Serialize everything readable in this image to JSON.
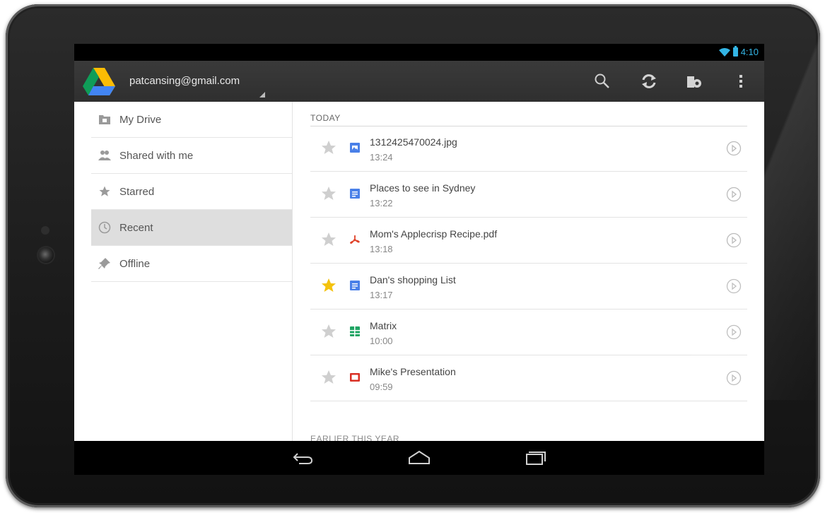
{
  "status_bar": {
    "time": "4:10",
    "wifi_icon": "wifi-icon",
    "battery_icon": "battery-icon"
  },
  "action_bar": {
    "account": "patcansing@gmail.com",
    "logo_icon": "google-drive-logo",
    "actions": [
      "search-icon",
      "refresh-icon",
      "offline-pin-icon",
      "overflow-menu-icon"
    ]
  },
  "sidebar": {
    "items": [
      {
        "label": "My Drive",
        "icon": "folder-icon",
        "selected": false
      },
      {
        "label": "Shared with me",
        "icon": "people-icon",
        "selected": false
      },
      {
        "label": "Starred",
        "icon": "star-icon",
        "selected": false
      },
      {
        "label": "Recent",
        "icon": "clock-icon",
        "selected": true
      },
      {
        "label": "Offline",
        "icon": "pin-icon",
        "selected": false
      }
    ]
  },
  "main": {
    "section_today": "TODAY",
    "section_earlier": "EARLIER THIS YEAR",
    "files": [
      {
        "name": "1312425470024.jpg",
        "time": "13:24",
        "starred": false,
        "type_icon": "image-icon"
      },
      {
        "name": "Places to see in Sydney",
        "time": "13:22",
        "starred": false,
        "type_icon": "document-icon"
      },
      {
        "name": "Mom's Applecrisp Recipe.pdf",
        "time": "13:18",
        "starred": false,
        "type_icon": "pdf-icon"
      },
      {
        "name": "Dan's shopping List",
        "time": "13:17",
        "starred": true,
        "type_icon": "document-icon"
      },
      {
        "name": "Matrix",
        "time": "10:00",
        "starred": false,
        "type_icon": "spreadsheet-icon"
      },
      {
        "name": "Mike's Presentation",
        "time": "09:59",
        "starred": false,
        "type_icon": "presentation-icon"
      }
    ]
  },
  "nav_bar": {
    "buttons": [
      "back-icon",
      "home-icon",
      "recent-apps-icon"
    ]
  },
  "colors": {
    "accent": "#33b5e5",
    "star_active": "#f4c20d",
    "star_inactive": "#cfcfcf",
    "doc_blue": "#4a80e8",
    "pdf_red": "#e0432a",
    "sheet_green": "#1fa463",
    "slides_red": "#d93025"
  }
}
